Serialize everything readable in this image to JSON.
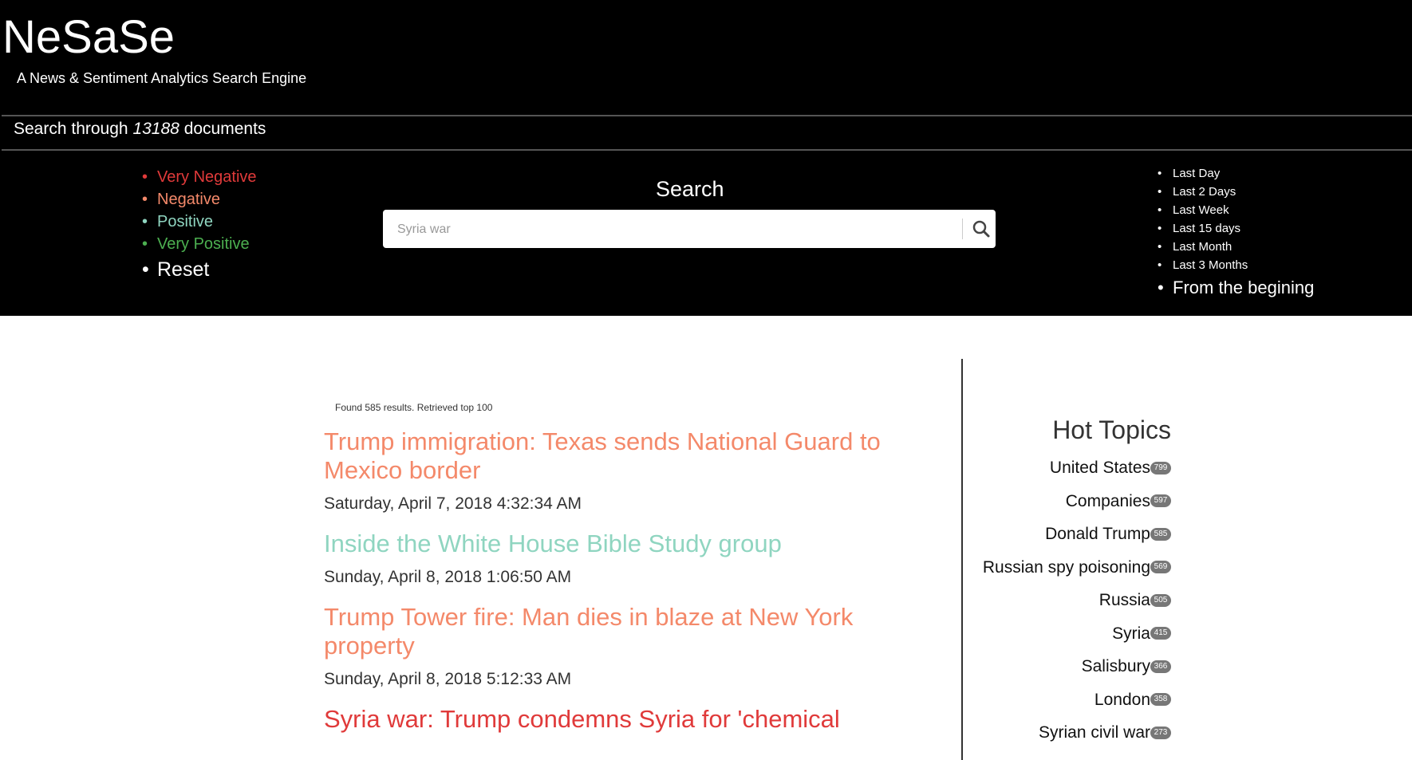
{
  "header": {
    "brand": "NeSaSe",
    "tagline": "A News & Sentiment Analytics Search Engine",
    "search_through_prefix": "Search through",
    "doc_count": "13188",
    "search_through_suffix": "documents"
  },
  "sentiment_filters": [
    {
      "label": "Very Negative",
      "color": "#e03a3a"
    },
    {
      "label": "Negative",
      "color": "#f4896a"
    },
    {
      "label": "Positive",
      "color": "#8fd5c0"
    },
    {
      "label": "Very Positive",
      "color": "#4caf50"
    },
    {
      "label": "Reset",
      "color": "#ffffff"
    }
  ],
  "search": {
    "title": "Search",
    "value": "Syria war",
    "button_icon": "search-icon"
  },
  "time_filters": [
    "Last Day",
    "Last 2 Days",
    "Last Week",
    "Last 15 days",
    "Last Month",
    "Last 3 Months",
    "From the begining"
  ],
  "results_summary": "Found 585 results. Retrieved top 100",
  "results": [
    {
      "title": "Trump immigration: Texas sends National Guard to Mexico border",
      "date": "Saturday, April 7, 2018 4:32:34 AM",
      "color": "#f4896a"
    },
    {
      "title": "Inside the White House Bible Study group",
      "date": "Sunday, April 8, 2018 1:06:50 AM",
      "color": "#8fd5c0"
    },
    {
      "title": "Trump Tower fire: Man dies in blaze at New York property",
      "date": "Sunday, April 8, 2018 5:12:33 AM",
      "color": "#f4896a"
    },
    {
      "title": "Syria war: Trump condemns Syria for 'chemical",
      "date": "",
      "color": "#e03a3a"
    }
  ],
  "hot_topics": {
    "title": "Hot Topics",
    "items": [
      {
        "name": "United States",
        "count": "799"
      },
      {
        "name": "Companies",
        "count": "597"
      },
      {
        "name": "Donald Trump",
        "count": "585"
      },
      {
        "name": "Russian spy poisoning",
        "count": "569"
      },
      {
        "name": "Russia",
        "count": "505"
      },
      {
        "name": "Syria",
        "count": "415"
      },
      {
        "name": "Salisbury",
        "count": "366"
      },
      {
        "name": "London",
        "count": "358"
      },
      {
        "name": "Syrian civil war",
        "count": "273"
      }
    ]
  }
}
